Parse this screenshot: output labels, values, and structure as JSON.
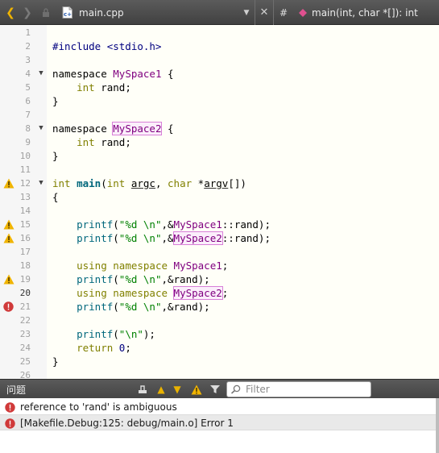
{
  "toolbar": {
    "file_name": "main.cpp",
    "hash": "#",
    "function": "main(int, char *[]): int"
  },
  "editor": {
    "current_line": 20,
    "lines": [
      {
        "num": "1"
      },
      {
        "num": "2",
        "t": [
          "#include <stdio.h>"
        ]
      },
      {
        "num": "3"
      },
      {
        "num": "4",
        "fold": true,
        "t": [
          "namespace ",
          "MySpace1",
          " {"
        ]
      },
      {
        "num": "5",
        "t": [
          "    ",
          "int",
          " rand;"
        ]
      },
      {
        "num": "6",
        "t": [
          "}"
        ]
      },
      {
        "num": "7"
      },
      {
        "num": "8",
        "fold": true,
        "t": [
          "namespace ",
          "MySpace2",
          " {"
        ]
      },
      {
        "num": "9",
        "t": [
          "    ",
          "int",
          " rand;"
        ]
      },
      {
        "num": "10",
        "t": [
          "}"
        ]
      },
      {
        "num": "11"
      },
      {
        "num": "12",
        "marker": "warning",
        "fold": true,
        "t": [
          "int",
          " ",
          "main",
          "(",
          "int",
          " ",
          "argc",
          ", ",
          "char",
          " *",
          "argv",
          "[])"
        ]
      },
      {
        "num": "13",
        "t": [
          "{"
        ]
      },
      {
        "num": "14"
      },
      {
        "num": "15",
        "marker": "warning",
        "t": [
          "    ",
          "printf",
          "(",
          "\"%d \\n\"",
          ",&",
          "MySpace1",
          "::rand);"
        ]
      },
      {
        "num": "16",
        "marker": "warning",
        "t": [
          "    ",
          "printf",
          "(",
          "\"%d \\n\"",
          ",&",
          "MySpace2",
          "::rand);"
        ]
      },
      {
        "num": "17"
      },
      {
        "num": "18",
        "t": [
          "    ",
          "using",
          " ",
          "namespace",
          " ",
          "MySpace1",
          ";"
        ]
      },
      {
        "num": "19",
        "marker": "warning",
        "t": [
          "    ",
          "printf",
          "(",
          "\"%d \\n\"",
          ",&rand);"
        ]
      },
      {
        "num": "20",
        "t": [
          "    ",
          "using",
          " ",
          "namespace",
          " ",
          "MySpace2",
          ";"
        ]
      },
      {
        "num": "21",
        "marker": "error",
        "t": [
          "    ",
          "printf",
          "(",
          "\"%d \\n\"",
          ",&rand);"
        ]
      },
      {
        "num": "22"
      },
      {
        "num": "23",
        "t": [
          "    ",
          "printf",
          "(",
          "\"\\n\"",
          ");"
        ]
      },
      {
        "num": "24",
        "t": [
          "    ",
          "return",
          " ",
          "0",
          ";"
        ]
      },
      {
        "num": "25",
        "t": [
          "}"
        ]
      },
      {
        "num": "26"
      }
    ]
  },
  "panel": {
    "title": "问题",
    "filter_placeholder": "Filter"
  },
  "issues": [
    {
      "text": "reference to 'rand' is ambiguous"
    },
    {
      "text": "[Makefile.Debug:125: debug/main.o] Error 1"
    }
  ],
  "colors": {
    "keyword": "#808000",
    "namespace": "#800080",
    "string": "#008000",
    "function": "#00677c",
    "warning": "#f0b400",
    "error": "#d03a3a"
  }
}
